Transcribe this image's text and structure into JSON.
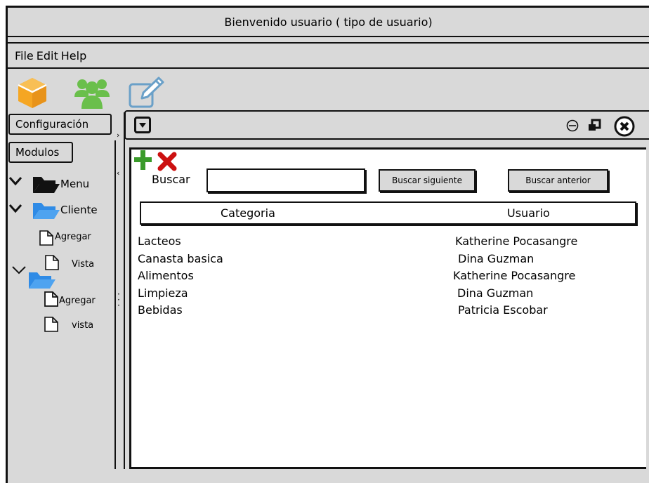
{
  "window": {
    "title": "Bienvenido usuario ( tipo de usuario)"
  },
  "menu": {
    "items": [
      "File",
      "Edit",
      "Help"
    ]
  },
  "toolbar": {
    "icons": [
      "box-icon",
      "users-icon",
      "edit-icon"
    ],
    "colors": {
      "box": "#f5a623",
      "users": "#6abf4b",
      "edit": "#6aa0c8"
    }
  },
  "sidebar": {
    "configuracion_label": "Configuración",
    "modulos_label": "Modulos",
    "tree": {
      "menu_label": "Menu",
      "cliente_label": "Cliente",
      "agregar1_label": "Agregar",
      "vista1_label": "Vista",
      "agregar2_label": "Agregar",
      "vista2_label": "vista"
    }
  },
  "panel": {
    "search_label": "Buscar",
    "search_value": "",
    "next_button": "Buscar siguiente",
    "prev_button": "Buscar anterior",
    "columns": [
      "Categoria",
      "Usuario"
    ],
    "rows": [
      {
        "categoria": "Lacteos",
        "usuario": "Katherine Pocasangre"
      },
      {
        "categoria": "Canasta basica",
        "usuario": "Dina Guzman"
      },
      {
        "categoria": "Alimentos",
        "usuario": "Katherine Pocasangre"
      },
      {
        "categoria": "Limpieza",
        "usuario": "Dina Guzman"
      },
      {
        "categoria": "Bebidas",
        "usuario": "Patricia Escobar"
      }
    ]
  }
}
